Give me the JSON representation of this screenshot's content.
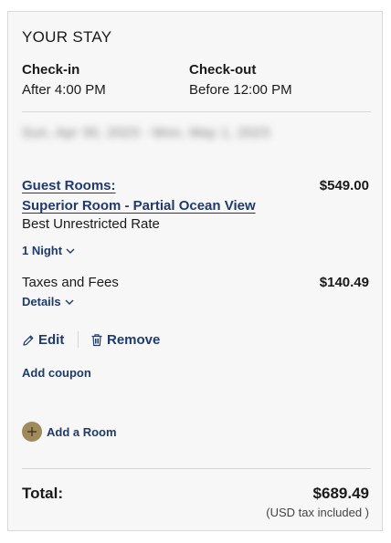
{
  "stay": {
    "title": "YOUR STAY",
    "checkin_label": "Check-in",
    "checkin_value": "After 4:00 PM",
    "checkout_label": "Check-out",
    "checkout_value": "Before 12:00 PM",
    "dates_blurred": "Sun, Apr 30, 2023 - Mon, May 1, 2023"
  },
  "room": {
    "line1": "Guest Rooms:",
    "line2": "Superior Room - Partial Ocean View",
    "price": "$549.00",
    "rate": "Best Unrestricted Rate",
    "nights_toggle": "1 Night",
    "nights_icon": "chevron-down-icon"
  },
  "fees": {
    "label": "Taxes and Fees",
    "amount": "$140.49",
    "details_toggle": "Details",
    "details_icon": "chevron-down-icon"
  },
  "actions": {
    "edit": "Edit",
    "edit_icon": "pencil-icon",
    "remove": "Remove",
    "remove_icon": "trash-icon",
    "coupon": "Add coupon",
    "add_room": "Add a Room",
    "add_room_icon": "plus-circle-icon"
  },
  "total": {
    "label": "Total:",
    "amount": "$689.49",
    "note": "(USD tax included )"
  },
  "colors": {
    "link": "#1f3a6e",
    "accent_circle": "#a08a5c",
    "card_bg": "#f7f7f7"
  }
}
